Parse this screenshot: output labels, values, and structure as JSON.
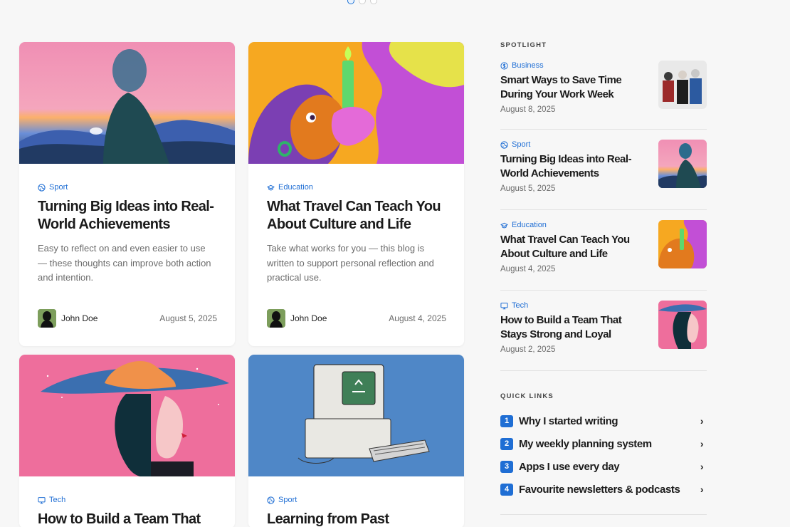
{
  "carousel": {
    "dots": 3,
    "active": 0
  },
  "colors": {
    "accent": "#1f6ed4",
    "bg": "#f7f7f7"
  },
  "cards": [
    {
      "category": "Sport",
      "category_icon": "globe-icon",
      "title": "Turning Big Ideas into Real-World Achievements",
      "excerpt": "Easy to reflect on and even easier to use — these thoughts can improve both action and intention.",
      "author": "John Doe",
      "date": "August 5, 2025",
      "image": "silhouette-woman-phone"
    },
    {
      "category": "Education",
      "category_icon": "graduation-cap-icon",
      "title": "What Travel Can Teach You About Culture and Life",
      "excerpt": "Take what works for you — this blog is written to support personal reflection and practical use.",
      "author": "John Doe",
      "date": "August 4, 2025",
      "image": "illustration-candle-faces"
    },
    {
      "category": "Tech",
      "category_icon": "monitor-icon",
      "title": "How to Build a Team That",
      "image": "woman-wide-hat"
    },
    {
      "category": "Sport",
      "category_icon": "globe-icon",
      "title": "Learning from Past",
      "image": "retro-computer"
    }
  ],
  "sidebar": {
    "spotlight_heading": "SPOTLIGHT",
    "spotlight": [
      {
        "category": "Business",
        "category_icon": "dollar-circle-icon",
        "title": "Smart Ways to Save Time During Your Work Week",
        "date": "August 8, 2025",
        "thumb": "group-people"
      },
      {
        "category": "Sport",
        "category_icon": "globe-icon",
        "title": "Turning Big Ideas into Real-World Achievements",
        "date": "August 5, 2025",
        "thumb": "silhouette-woman-phone"
      },
      {
        "category": "Education",
        "category_icon": "graduation-cap-icon",
        "title": "What Travel Can Teach You About Culture and Life",
        "date": "August 4, 2025",
        "thumb": "illustration-candle-faces"
      },
      {
        "category": "Tech",
        "category_icon": "monitor-icon",
        "title": "How to Build a Team That Stays Strong and Loyal",
        "date": "August 2, 2025",
        "thumb": "woman-wide-hat"
      }
    ],
    "quick_links_heading": "QUICK LINKS",
    "quick_links": [
      {
        "num": "1",
        "label": "Why I started writing"
      },
      {
        "num": "2",
        "label": "My weekly planning system"
      },
      {
        "num": "3",
        "label": "Apps I use every day"
      },
      {
        "num": "4",
        "label": "Favourite newsletters & podcasts"
      }
    ]
  }
}
